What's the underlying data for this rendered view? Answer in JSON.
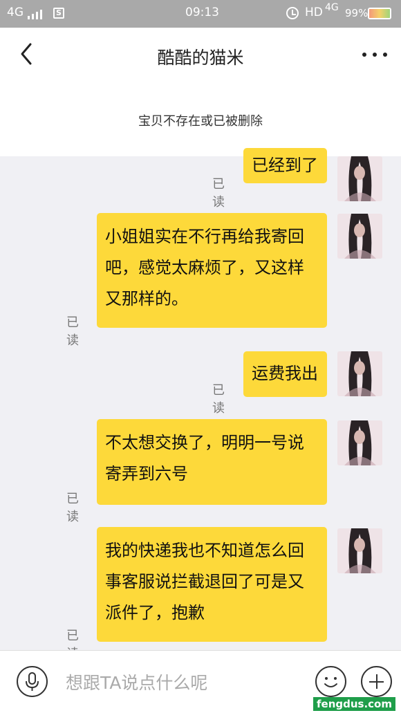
{
  "status_bar": {
    "network_left": "4G",
    "time": "09:13",
    "hd_label": "HD",
    "network_right": "4G",
    "battery_percent": "99%",
    "battery_level": 0.99
  },
  "header": {
    "title": "酷酷的猫米",
    "back_icon": "chevron-left-icon",
    "more_icon": "more-dots-icon"
  },
  "product_notice": "宝贝不存在或已被删除",
  "messages": [
    {
      "text": "已经到了",
      "read_label": "已读"
    },
    {
      "text": "小姐姐实在不行再给我寄回\n吧，感觉太麻烦了，又这样\n又那样的。",
      "read_label": "已读"
    },
    {
      "text": "运费我出",
      "read_label": "已读"
    },
    {
      "text": "不太想交换了，明明一号说\n寄弄到六号",
      "read_label": "已读"
    },
    {
      "text": "我的快递我也不知道怎么回\n事客服说拦截退回了可是又\n派件了，抱歉",
      "read_label": "已读"
    }
  ],
  "composer": {
    "placeholder": "想跟TA说点什么呢",
    "value": ""
  },
  "watermark": "fengdus.com",
  "colors": {
    "bubble": "#fdd93a",
    "status_bar": "#a9a9a9",
    "chat_bg": "#f0f0f4"
  }
}
